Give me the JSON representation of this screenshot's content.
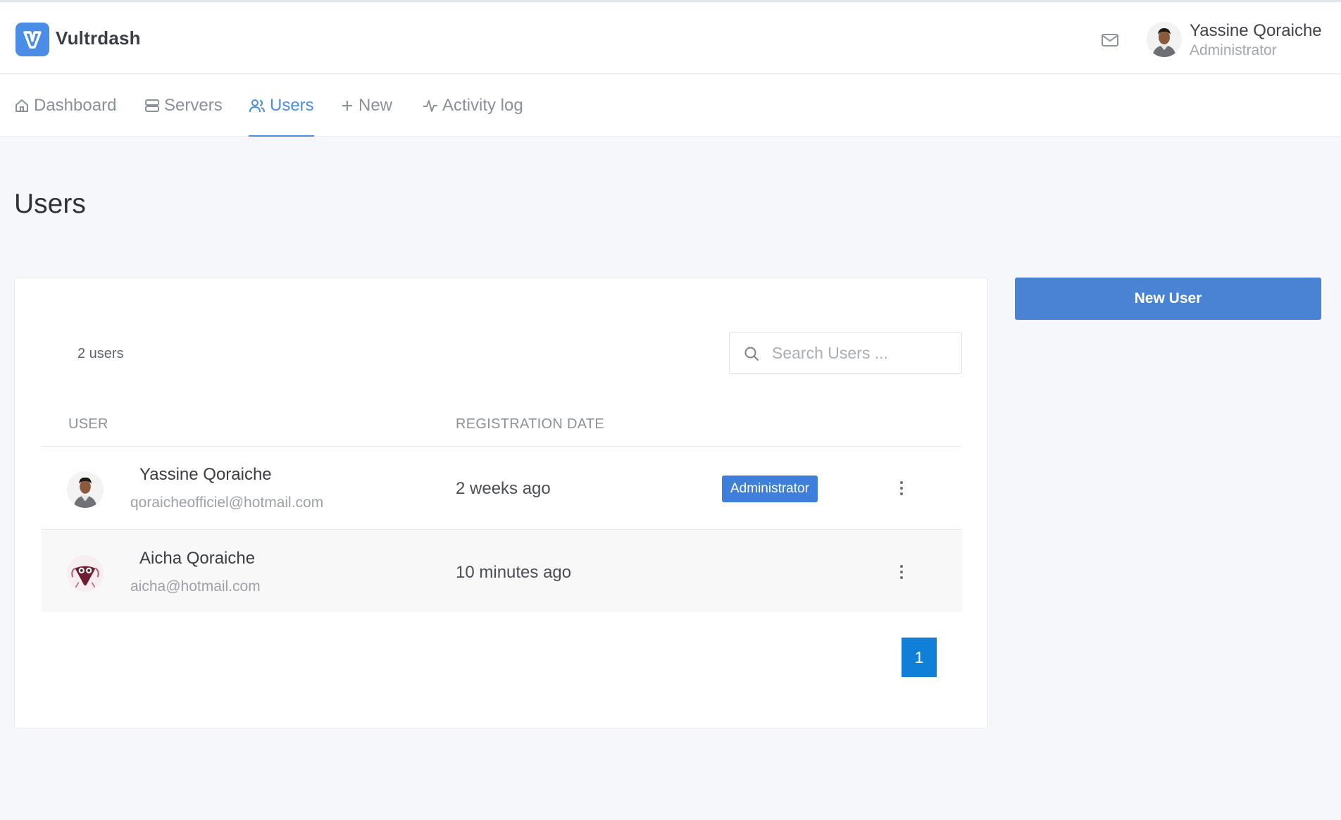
{
  "app": {
    "brand": "Vultrdash",
    "logo_letter": "V",
    "accent_color": "#4a8de6"
  },
  "header": {
    "user_name": "Yassine Qoraiche",
    "user_role": "Administrator",
    "icons": [
      "mail-icon",
      "avatar"
    ]
  },
  "nav": {
    "items": [
      {
        "label": "Dashboard",
        "icon": "home-icon",
        "active": false
      },
      {
        "label": "Servers",
        "icon": "server-icon",
        "active": false
      },
      {
        "label": "Users",
        "icon": "users-icon",
        "active": true
      },
      {
        "label": "New",
        "icon": "plus-icon",
        "active": false
      },
      {
        "label": "Activity log",
        "icon": "activity-icon",
        "active": false
      }
    ]
  },
  "page": {
    "title": "Users",
    "new_user_label": "New User"
  },
  "table": {
    "count_label": "2 users",
    "search_placeholder": "Search Users ...",
    "columns": [
      "USER",
      "REGISTRATION DATE"
    ],
    "rows": [
      {
        "name": "Yassine Qoraiche",
        "email": "qoraicheofficiel@hotmail.com",
        "registered": "2 weeks ago",
        "badge": "Administrator"
      },
      {
        "name": "Aicha Qoraiche",
        "email": "aicha@hotmail.com",
        "registered": "10 minutes ago",
        "badge": null
      }
    ]
  },
  "pagination": {
    "current_page": "1"
  }
}
